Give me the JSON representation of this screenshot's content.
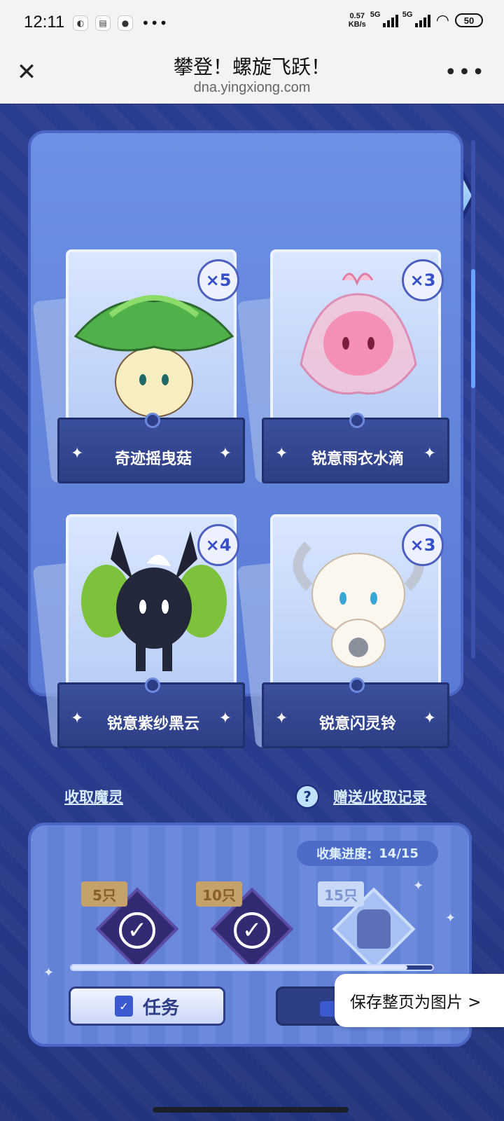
{
  "status_bar": {
    "time": "12:11",
    "net_speed": "0.57\nKB/s",
    "net1": "5G",
    "net2": "5G",
    "battery": "50"
  },
  "browser": {
    "title": "攀登！螺旋飞跃！",
    "url": "dna.yingxiong.com",
    "close_icon": "close-icon",
    "more_icon": "more-icon"
  },
  "toolbar": {
    "buttons": [
      "home",
      "help",
      "music-off",
      "share"
    ]
  },
  "cards": [
    {
      "name": "奇迹摇曳菇",
      "count": "×5"
    },
    {
      "name": "锐意雨衣水滴",
      "count": "×3"
    },
    {
      "name": "锐意紫纱黑云",
      "count": "×4"
    },
    {
      "name": "锐意闪灵铃",
      "count": "×3"
    }
  ],
  "links": {
    "receive": "收取魔灵",
    "records": "赠送/收取记录"
  },
  "progress": {
    "label": "收集进度:",
    "value": "14/15",
    "fraction": 0.93,
    "milestones": [
      {
        "label": "5只",
        "done": true
      },
      {
        "label": "10只",
        "done": true
      },
      {
        "label": "15只",
        "done": false
      }
    ]
  },
  "buttons": {
    "task": "任务"
  },
  "overlay": {
    "save": "保存整页为图片 >"
  },
  "colors": {
    "accent": "#3b5ad0",
    "panel": "#6c90e3",
    "background": "#2a3c8e"
  }
}
